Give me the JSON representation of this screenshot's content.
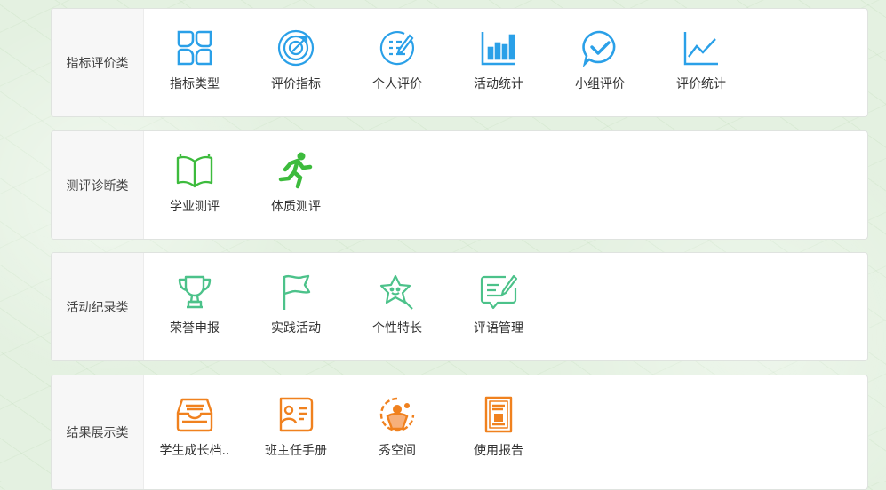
{
  "colors": {
    "blue": "#2aa0e8",
    "green": "#3dbb3d",
    "teal": "#4cc28a",
    "orange": "#f0811e"
  },
  "sections": [
    {
      "category": "指标评价类",
      "items": [
        {
          "label": "指标类型",
          "icon": "grid-blocks-icon"
        },
        {
          "label": "评价指标",
          "icon": "target-arrow-icon"
        },
        {
          "label": "个人评价",
          "icon": "checklist-edit-icon"
        },
        {
          "label": "活动统计",
          "icon": "bar-chart-icon"
        },
        {
          "label": "小组评价",
          "icon": "chat-check-icon"
        },
        {
          "label": "评价统计",
          "icon": "line-chart-icon"
        }
      ]
    },
    {
      "category": "测评诊断类",
      "items": [
        {
          "label": "学业测评",
          "icon": "open-book-icon"
        },
        {
          "label": "体质测评",
          "icon": "running-person-icon"
        }
      ]
    },
    {
      "category": "活动纪录类",
      "items": [
        {
          "label": "荣誉申报",
          "icon": "trophy-icon"
        },
        {
          "label": "实践活动",
          "icon": "flag-icon"
        },
        {
          "label": "个性特长",
          "icon": "star-face-icon"
        },
        {
          "label": "评语管理",
          "icon": "comment-edit-icon"
        }
      ]
    },
    {
      "category": "结果展示类",
      "items": [
        {
          "label": "学生成长档..",
          "icon": "archive-tray-icon"
        },
        {
          "label": "班主任手册",
          "icon": "teacher-handbook-icon"
        },
        {
          "label": "秀空间",
          "icon": "show-space-icon"
        },
        {
          "label": "使用报告",
          "icon": "report-document-icon"
        }
      ]
    }
  ]
}
